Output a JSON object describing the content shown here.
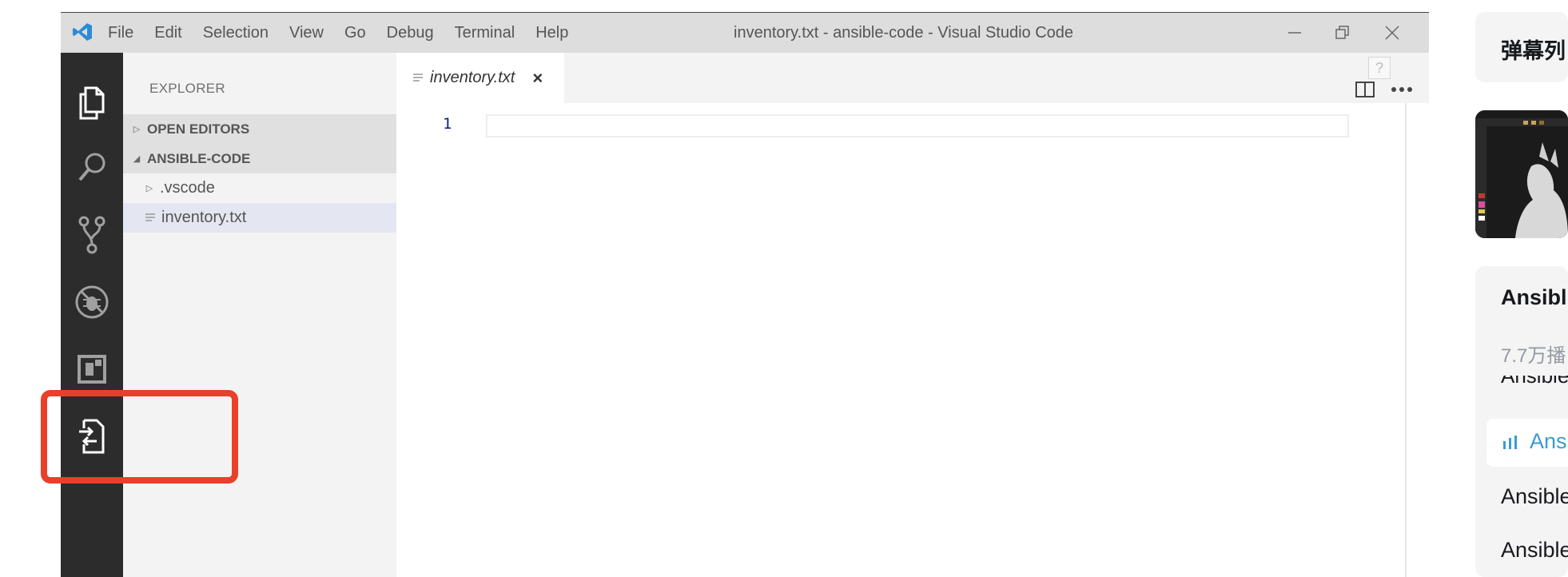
{
  "window": {
    "title": "inventory.txt - ansible-code - Visual Studio Code",
    "menu": [
      "File",
      "Edit",
      "Selection",
      "View",
      "Go",
      "Debug",
      "Terminal",
      "Help"
    ]
  },
  "activity_bar": [
    "files-icon",
    "search-icon",
    "source-control-icon",
    "debug-icon",
    "extensions-icon",
    "remote-explorer-icon"
  ],
  "sidebar": {
    "title": "EXPLORER",
    "sections": {
      "open_editors": "OPEN EDITORS",
      "project": "ANSIBLE-CODE"
    },
    "files": [
      {
        "name": ".vscode",
        "type": "folder"
      },
      {
        "name": "inventory.txt",
        "type": "file"
      }
    ]
  },
  "editor": {
    "tab_name": "inventory.txt",
    "line_number": "1",
    "help_glyph": "?"
  },
  "right_panel": {
    "danmaku_title": "弹幕列",
    "video_title": "Ansibl",
    "views": "7.7万播",
    "playlist": [
      "Ansible",
      "Ans",
      "Ansible",
      "Ansible"
    ]
  },
  "colors": {
    "accent_blue": "#2d8bd6",
    "highlight_red": "#e8402b",
    "playing_blue": "#3a9bd5"
  }
}
